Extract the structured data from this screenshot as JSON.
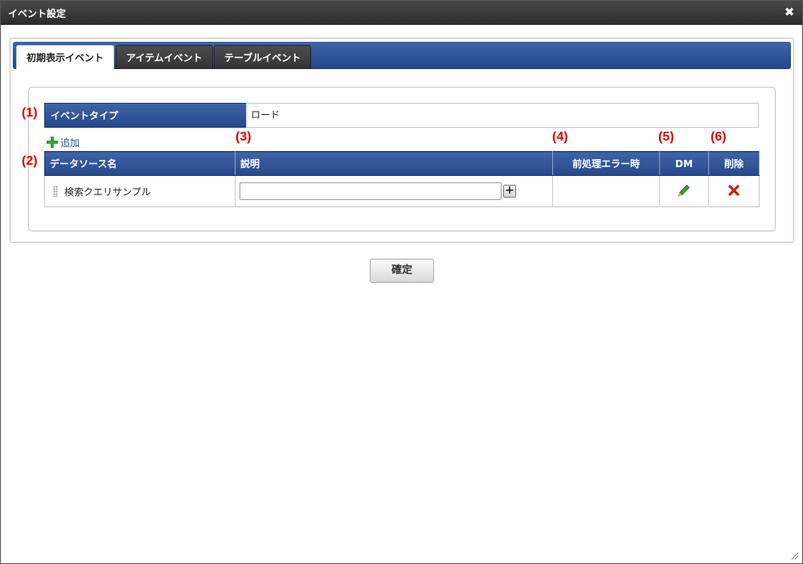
{
  "dialog": {
    "title": "イベント設定",
    "close_glyph": "✖"
  },
  "tabs": [
    {
      "label": "初期表示イベント",
      "active": true
    },
    {
      "label": "アイテムイベント",
      "active": false
    },
    {
      "label": "テーブルイベント",
      "active": false
    }
  ],
  "annotations": {
    "n1": "(1)",
    "n2": "(2)",
    "n3": "(3)",
    "n4": "(4)",
    "n5": "(5)",
    "n6": "(6)"
  },
  "event_type": {
    "label": "イベントタイプ",
    "value": "ロード"
  },
  "add_link": {
    "label": "追加",
    "icon": "plus-icon"
  },
  "table": {
    "headers": {
      "datasource": "データソース名",
      "description": "説明",
      "preprocess_error": "前処理エラー時",
      "dm": "DM",
      "delete": "削除"
    },
    "rows": [
      {
        "datasource": "検索クエリサンプル",
        "description": "",
        "expand_glyph": "+",
        "preprocess_error": "",
        "dm_icon": "pencil-icon",
        "delete_icon": "delete-x-icon"
      }
    ]
  },
  "confirm_button": {
    "label": "確定"
  },
  "colors": {
    "header_blue": "#2f559a",
    "annotation_red": "#e00000",
    "add_green": "#2ea42e",
    "delete_red": "#d11a1a",
    "edit_green": "#3d9a2b"
  }
}
